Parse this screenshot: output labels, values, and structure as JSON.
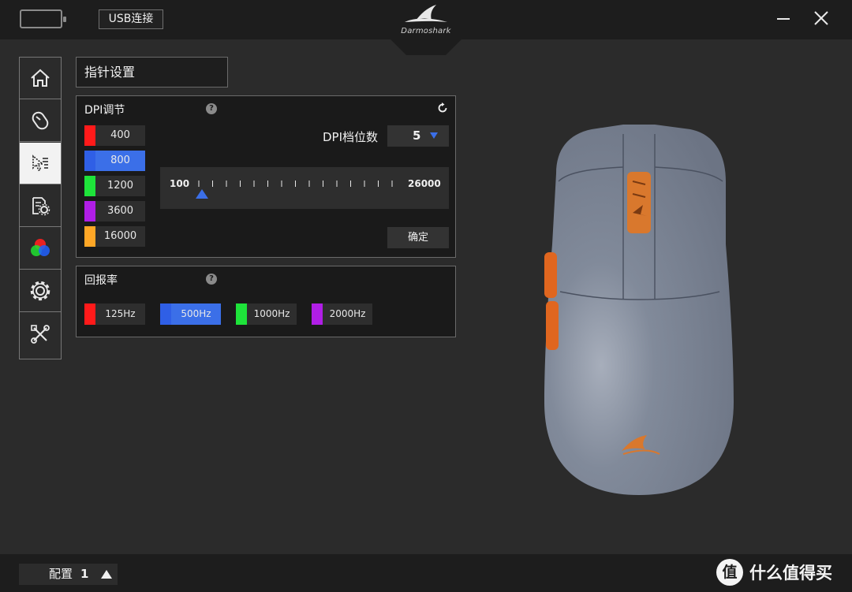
{
  "topbar": {
    "connection_label": "USB连接",
    "brand_name": "Darmoshark"
  },
  "sidebar": {
    "items": [
      {
        "name": "home",
        "icon": "home-icon"
      },
      {
        "name": "mouse",
        "icon": "mouse-icon"
      },
      {
        "name": "pointer-settings",
        "icon": "cursor-icon",
        "active": true
      },
      {
        "name": "macro",
        "icon": "document-gear-icon"
      },
      {
        "name": "lighting",
        "icon": "rgb-icon"
      },
      {
        "name": "settings",
        "icon": "gear-icon"
      },
      {
        "name": "tools",
        "icon": "tools-icon"
      }
    ]
  },
  "page": {
    "title": "指针设置"
  },
  "dpi_panel": {
    "title": "DPI调节",
    "help": "?",
    "stages": [
      {
        "value": "400",
        "color": "#ff1a1a"
      },
      {
        "value": "800",
        "color": "#2f5fe6",
        "selected": true
      },
      {
        "value": "1200",
        "color": "#1ee33a"
      },
      {
        "value": "3600",
        "color": "#b01ee6"
      },
      {
        "value": "16000",
        "color": "#ffa726"
      }
    ],
    "levels_label": "DPI档位数",
    "levels_value": "5",
    "slider_min": "100",
    "slider_max": "26000",
    "confirm_label": "确定"
  },
  "rate_panel": {
    "title": "回报率",
    "help": "?",
    "options": [
      {
        "value": "125Hz",
        "color": "#ff1a1a"
      },
      {
        "value": "500Hz",
        "color": "#2f5fe6",
        "selected": true
      },
      {
        "value": "1000Hz",
        "color": "#1ee33a"
      },
      {
        "value": "2000Hz",
        "color": "#b01ee6"
      }
    ]
  },
  "bottombar": {
    "profile_label": "配置",
    "profile_number": "1",
    "watermark_logo": "值",
    "watermark_text": "什么值得买"
  },
  "colors": {
    "accent_blue": "#3b6fe8",
    "mouse_body": "#7a8394",
    "mouse_accent": "#e0661f"
  }
}
